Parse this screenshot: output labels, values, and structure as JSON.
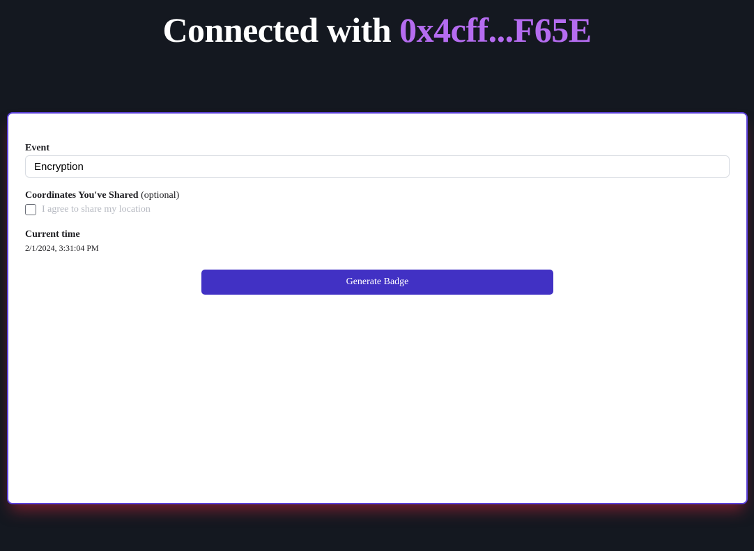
{
  "header": {
    "prefix": "Connected with ",
    "address": "0x4cff...F65E"
  },
  "form": {
    "event_label": "Event",
    "event_value": "Encryption",
    "coords_label": "Coordinates You've Shared",
    "coords_optional": "(optional)",
    "location_checkbox_label": "I agree to share my location",
    "location_checked": false,
    "time_label": "Current time",
    "time_value": "2/1/2024, 3:31:04 PM",
    "generate_button": "Generate Badge"
  },
  "colors": {
    "background": "#141820",
    "address_accent": "#b56cf0",
    "card_border": "#5a40d8",
    "button": "#4131c4"
  }
}
